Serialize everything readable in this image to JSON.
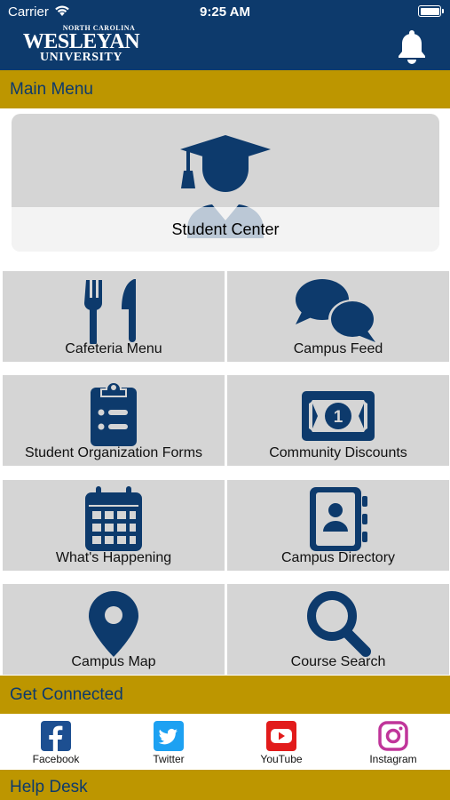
{
  "status_bar": {
    "carrier": "Carrier",
    "time": "9:25 AM"
  },
  "header": {
    "logo_line1": "NORTH CAROLINA",
    "logo_line2": "WESLEYAN",
    "logo_line3": "UNIVERSITY"
  },
  "sections": {
    "main_menu": "Main Menu",
    "get_connected": "Get Connected",
    "help_desk": "Help Desk"
  },
  "hero": {
    "label": "Student Center",
    "icon": "graduate-icon"
  },
  "tiles": [
    {
      "label": "Cafeteria Menu",
      "icon": "utensils-icon"
    },
    {
      "label": "Campus Feed",
      "icon": "chat-bubbles-icon"
    },
    {
      "label": "Student Organization Forms",
      "icon": "clipboard-list-icon"
    },
    {
      "label": "Community Discounts",
      "icon": "money-bill-icon"
    },
    {
      "label": "What's Happening",
      "icon": "calendar-icon"
    },
    {
      "label": "Campus Directory",
      "icon": "address-book-icon"
    },
    {
      "label": "Campus Map",
      "icon": "map-pin-icon"
    },
    {
      "label": "Course Search",
      "icon": "search-icon"
    }
  ],
  "social": [
    {
      "label": "Facebook",
      "icon": "facebook-icon",
      "color": "#1d4f91"
    },
    {
      "label": "Twitter",
      "icon": "twitter-icon",
      "color": "#1da1f2"
    },
    {
      "label": "YouTube",
      "icon": "youtube-icon",
      "color": "#e21b1b"
    },
    {
      "label": "Instagram",
      "icon": "instagram-icon",
      "color": "#c0359a"
    }
  ],
  "colors": {
    "navy": "#0d3a6c",
    "gold": "#bd9600",
    "tile": "#d5d5d5"
  }
}
